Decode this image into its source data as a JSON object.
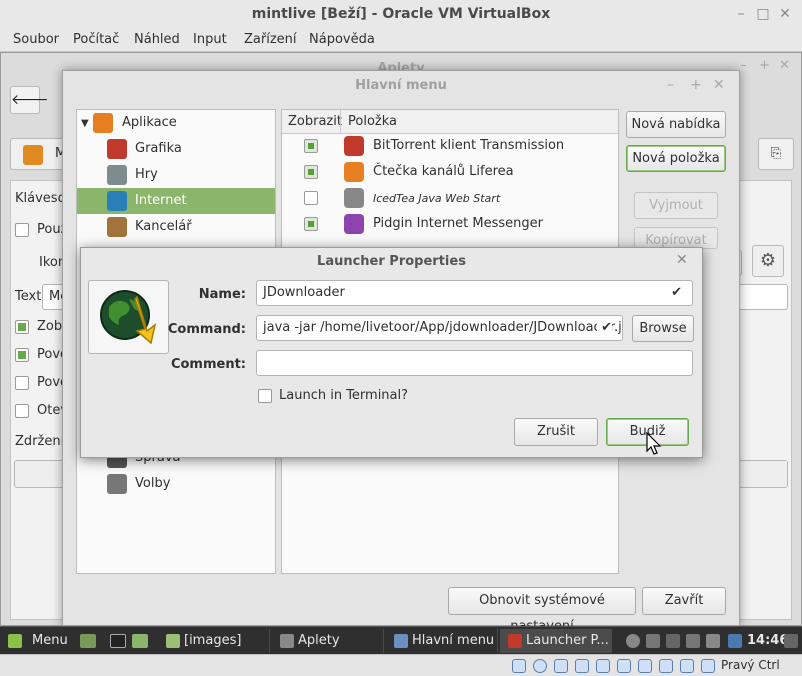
{
  "vbox": {
    "title": "mintlive [Beží] - Oracle VM VirtualBox",
    "menu": [
      "Soubor",
      "Počítač",
      "Náhled",
      "Input",
      "Zařízení",
      "Nápověda"
    ],
    "status_right": "Pravý Ctrl"
  },
  "aplety": {
    "title": "Aplety",
    "tab_label": "M",
    "labels": [
      "Klávesov",
      "Použ",
      "Ikon",
      "Text",
      "Zobr",
      "Povo",
      "Povo",
      "Otev",
      "Zdržení z"
    ],
    "text_field_value": "Me"
  },
  "hlavni_menu": {
    "title": "Hlavní menu",
    "categories": [
      {
        "label": "Aplikace",
        "icon": "applications-icon",
        "color": "#e67e22"
      },
      {
        "label": "Grafika",
        "icon": "graphics-icon",
        "color": "#c0392b"
      },
      {
        "label": "Hry",
        "icon": "games-icon",
        "color": "#7f8c8d"
      },
      {
        "label": "Internet",
        "icon": "internet-icon",
        "color": "#2980b9"
      },
      {
        "label": "Kancelář",
        "icon": "office-icon",
        "color": "#a0743a"
      },
      {
        "label": "Správa",
        "icon": "administration-icon",
        "color": "#555555"
      },
      {
        "label": "Volby",
        "icon": "preferences-icon",
        "color": "#777777"
      }
    ],
    "columns": {
      "show": "Zobrazit",
      "item": "Položka"
    },
    "items": [
      {
        "label": "BitTorrent klient Transmission",
        "checked": true,
        "icon": "transmission-icon",
        "color": "#c0392b"
      },
      {
        "label": "Čtečka kanálů Liferea",
        "checked": true,
        "icon": "rss-feed-icon",
        "color": "#e67e22"
      },
      {
        "label": "IcedTea Java Web Start",
        "checked": false,
        "icon": "java-icon",
        "color": "#888888"
      },
      {
        "label": "Pidgin Internet Messenger",
        "checked": true,
        "icon": "pidgin-icon",
        "color": "#8e44ad"
      }
    ],
    "buttons": {
      "new_menu": "Nová nabídka",
      "new_item": "Nová položka",
      "cut": "Vyjmout",
      "copy": "Kopírovat",
      "restore": "Obnovit systémové nastavení",
      "close": "Zavřít"
    }
  },
  "launcher": {
    "title": "Launcher Properties",
    "name_label": "Name:",
    "name_value": "JDownloader",
    "command_label": "Command:",
    "command_value": "java -jar /home/livetoor/App/jdownloader/JDownloader.jar",
    "browse": "Browse",
    "comment_label": "Comment:",
    "comment_value": "",
    "terminal_label": "Launch in Terminal?",
    "cancel": "Zrušit",
    "ok": "Budiž"
  },
  "taskbar": {
    "menu_label": "Menu",
    "windows": [
      "[images]",
      "Aplety",
      "Hlavní menu",
      "Launcher P..."
    ],
    "clock": "14:46"
  }
}
